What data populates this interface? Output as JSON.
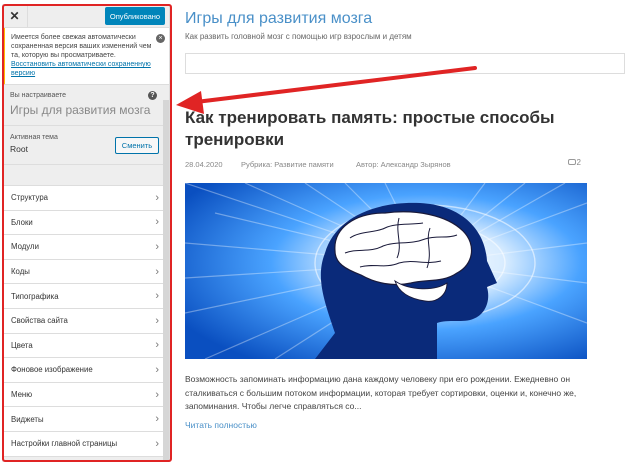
{
  "customizer": {
    "close_icon": "close-icon",
    "publish_label": "Опубликовано",
    "notice_text": "Имеется более свежая автоматически сохраненная версия ваших изменений чем та, которую вы просматриваете.",
    "notice_link": "Восстановить автоматически сохраненную версию",
    "customizing_label": "Вы настраиваете",
    "site_name": "Игры для развития мозга",
    "active_theme_label": "Активная тема",
    "active_theme_name": "Root",
    "change_label": "Сменить",
    "menu_items": [
      {
        "label": "Структура"
      },
      {
        "label": "Блоки"
      },
      {
        "label": "Модули"
      },
      {
        "label": "Коды"
      },
      {
        "label": "Типографика"
      },
      {
        "label": "Свойства сайта"
      },
      {
        "label": "Цвета"
      },
      {
        "label": "Фоновое изображение"
      },
      {
        "label": "Меню"
      },
      {
        "label": "Виджеты"
      },
      {
        "label": "Настройки главной страницы"
      }
    ]
  },
  "preview": {
    "site_title": "Игры для развития мозга",
    "site_description": "Как развить головной мозг с помощью игр взрослым и детям",
    "post_title": "Как тренировать память: простые способы тренировки",
    "date": "28.04.2020",
    "category": "Рубрика: Развитие памяти",
    "author": "Автор: Александр Зырянов",
    "comments_count": "2",
    "excerpt": "Возможность запоминать информацию дана каждому человеку при его рождении. Ежедневно он сталкиваться с большим потоком информации, которая требует сортировки, оценки и, конечно же, запоминания. Чтобы легче справляться со...",
    "read_more": "Читать полностью"
  },
  "colors": {
    "accent": "#0085ba",
    "link": "#4a90c8",
    "highlight_frame": "#e02424",
    "notice_border": "#ffb900"
  }
}
